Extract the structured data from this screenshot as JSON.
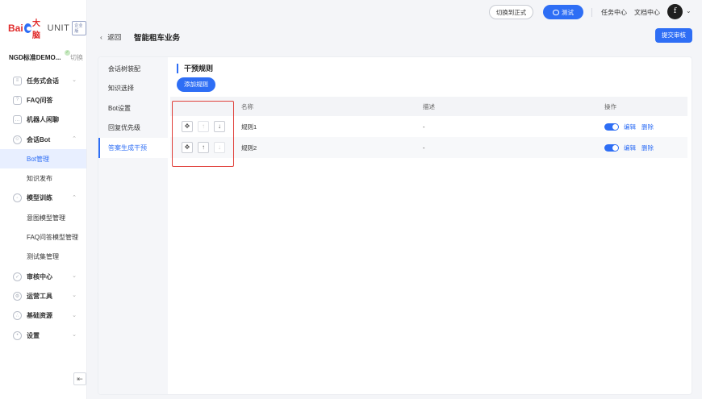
{
  "brand": {
    "bai": "Bai",
    "cn": "大脑",
    "unit": "UNIT",
    "edition": "企业版"
  },
  "project": {
    "name": "NGD标准DEMO...",
    "switch_label": "切换",
    "badge": "✓"
  },
  "nav": {
    "task_dialog": "任务式会话",
    "faq": "FAQ问答",
    "chitchat": "机器人闲聊",
    "dialog_bot": "会话Bot",
    "bot_manage": "Bot管理",
    "knowledge_publish": "知识发布",
    "model_training": "模型训练",
    "intent_model": "意图模型管理",
    "faq_model": "FAQ问答模型管理",
    "testset": "测试集管理",
    "review_center": "审核中心",
    "ops_tools": "运营工具",
    "base_resources": "基础资源",
    "settings": "设置",
    "collapse": "⇤"
  },
  "topbar": {
    "switch_formal": "切换到正式",
    "test": "测试",
    "task_center": "任务中心",
    "doc_center": "文档中心",
    "avatar_letter": "f"
  },
  "subheader": {
    "back": "返回",
    "title": "智能租车业务",
    "submit": "提交审核"
  },
  "panel_menu": [
    "会话树装配",
    "知识选择",
    "Bot设置",
    "回复优先级",
    "答案生成干预"
  ],
  "section": {
    "title": "干预规则",
    "add_button": "添加规则"
  },
  "table": {
    "headers": {
      "name": "名称",
      "desc": "描述",
      "op": "操作"
    },
    "rows": [
      {
        "name": "规则1",
        "desc": "-",
        "enabled": true,
        "edit": "编辑",
        "delete": "删除",
        "up_disabled": true,
        "down_disabled": false
      },
      {
        "name": "规则2",
        "desc": "-",
        "enabled": true,
        "edit": "编辑",
        "delete": "删除",
        "up_disabled": false,
        "down_disabled": true
      }
    ]
  },
  "colors": {
    "accent": "#2e6ef5",
    "highlight": "#e0403a",
    "brand_red": "#e02b2b"
  }
}
